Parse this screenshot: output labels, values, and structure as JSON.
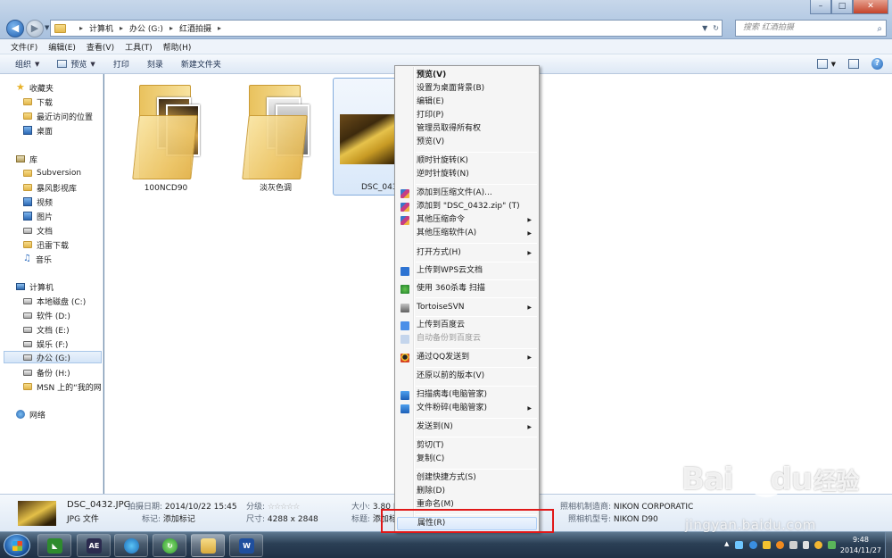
{
  "window": {
    "breadcrumb": [
      "计算机",
      "办公 (G:)",
      "红酒拍摄"
    ],
    "search_placeholder": "搜索 红酒拍摄"
  },
  "menu": [
    "文件(F)",
    "编辑(E)",
    "查看(V)",
    "工具(T)",
    "帮助(H)"
  ],
  "commands": {
    "organize": "组织",
    "preview": "预览",
    "print": "打印",
    "burn": "刻录",
    "new_folder": "新建文件夹"
  },
  "nav": {
    "favorites": "收藏夹",
    "fav_items": [
      "下载",
      "最近访问的位置",
      "桌面"
    ],
    "libraries": "库",
    "lib_items": [
      "Subversion",
      "暴风影视库",
      "视频",
      "图片",
      "文档",
      "迅雷下载",
      "音乐"
    ],
    "computer": "计算机",
    "drives": [
      "本地磁盘 (C:)",
      "软件 (D:)",
      "文档 (E:)",
      "娱乐 (F:)",
      "办公 (G:)",
      "备份 (H:)",
      "MSN 上的“我的网"
    ],
    "network": "网络"
  },
  "files": [
    {
      "name": "100NCD90",
      "type": "folder"
    },
    {
      "name": "淡灰色调",
      "type": "folder"
    },
    {
      "name": "DSC_043",
      "type": "photo"
    }
  ],
  "details": {
    "filename": "DSC_0432.JPG",
    "filetype": "JPG 文件",
    "date_label": "拍摄日期:",
    "date_value": "2014/10/22 15:45",
    "tag_label": "标记:",
    "tag_value": "添加标记",
    "rating_label": "分级:",
    "rating_stars": "☆☆☆☆☆",
    "dims_label": "尺寸:",
    "dims_value": "4288 x 2848",
    "size_label": "大小:",
    "size_value": "3.80 M",
    "title_label": "标题:",
    "title_value": "添加标",
    "maker_label": "照相机制造商:",
    "maker_value": "NIKON CORPORATIC",
    "model_label": "照相机型号:",
    "model_value": "NIKON D90"
  },
  "context_menu": {
    "items": [
      {
        "label": "预览(V)",
        "bold": true
      },
      {
        "label": "设置为桌面背景(B)"
      },
      {
        "label": "编辑(E)"
      },
      {
        "label": "打印(P)"
      },
      {
        "label": "管理员取得所有权"
      },
      {
        "label": "预览(V)"
      },
      {
        "label": "顺时针旋转(K)"
      },
      {
        "label": "逆时针旋转(N)"
      },
      {
        "label": "添加到压缩文件(A)...",
        "icon": "winrar-icon"
      },
      {
        "label": "添加到 \"DSC_0432.zip\" (T)",
        "icon": "winrar-icon"
      },
      {
        "label": "其他压缩命令",
        "icon": "winrar-icon",
        "submenu": true
      },
      {
        "label": "其他压缩软件(A)",
        "submenu": true
      },
      {
        "label": "打开方式(H)",
        "submenu": true
      },
      {
        "label": "上传到WPS云文档",
        "icon": "wps-icon"
      },
      {
        "label": "使用 360杀毒 扫描",
        "icon": "antivirus-360-icon"
      },
      {
        "label": "TortoiseSVN",
        "icon": "tortoisesvn-icon",
        "submenu": true
      },
      {
        "label": "上传到百度云",
        "icon": "baidu-cloud-icon"
      },
      {
        "label": "自动备份到百度云",
        "icon": "baidu-cloud-icon",
        "disabled": true
      },
      {
        "label": "通过QQ发送到",
        "icon": "qq-icon",
        "submenu": true
      },
      {
        "label": "还原以前的版本(V)"
      },
      {
        "label": "扫描病毒(电脑管家)",
        "icon": "pc-manager-icon"
      },
      {
        "label": "文件粉碎(电脑管家)",
        "icon": "pc-manager-icon",
        "submenu": true
      },
      {
        "label": "发送到(N)",
        "submenu": true
      },
      {
        "label": "剪切(T)"
      },
      {
        "label": "复制(C)"
      },
      {
        "label": "创建快捷方式(S)"
      },
      {
        "label": "删除(D)"
      },
      {
        "label": "重命名(M)"
      },
      {
        "label": "属性(R)",
        "highlighted": true
      }
    ]
  },
  "taskbar": {
    "apps": [
      "AE"
    ],
    "word_icon": "W",
    "time": "9:48",
    "date": "2014/11/27"
  },
  "watermark": {
    "logo": "Bai",
    "logo2": "du",
    "cn": "经验",
    "url": "jingyan.baidu.com"
  },
  "colors": {
    "highlight_box": "#e01818",
    "selection": "#d9e8f9"
  }
}
